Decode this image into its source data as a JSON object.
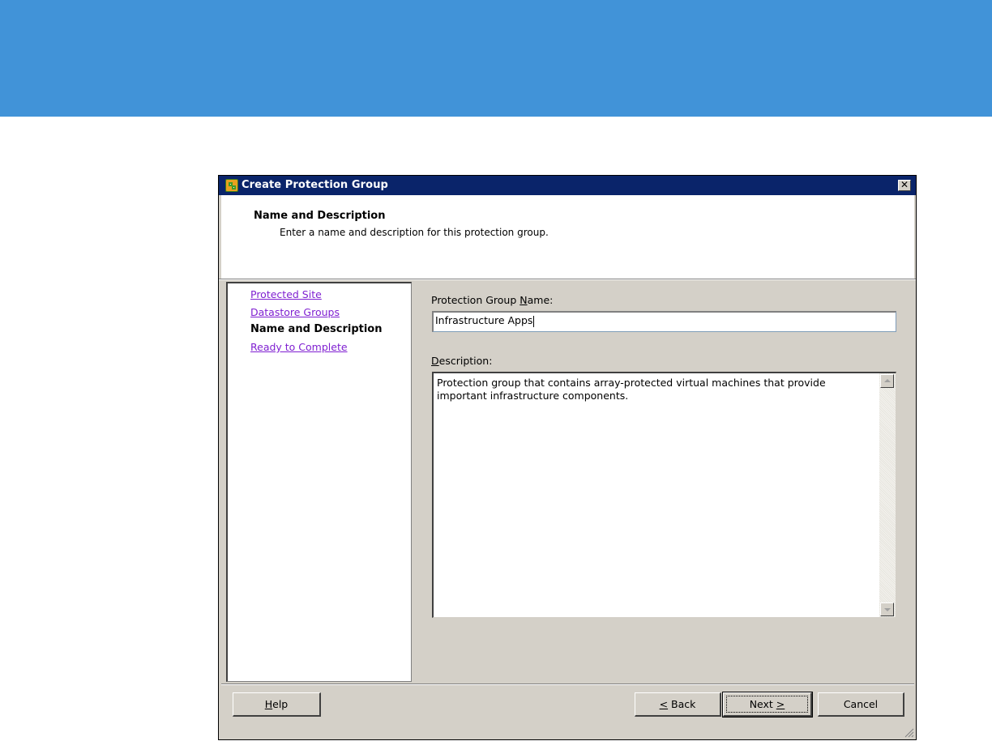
{
  "dialog": {
    "title": "Create Protection Group",
    "close_glyph": "✕",
    "header": {
      "title": "Name and Description",
      "subtitle": "Enter a name and description for this protection group."
    },
    "steps": [
      {
        "label": "Protected Site",
        "state": "link"
      },
      {
        "label": "Datastore Groups",
        "state": "link"
      },
      {
        "label": "Name and Description",
        "state": "current"
      },
      {
        "label": "Ready to Complete",
        "state": "link"
      }
    ],
    "name_field": {
      "label_pre": "Protection Group ",
      "label_accel": "N",
      "label_post": "ame:",
      "value": "Infrastructure Apps"
    },
    "description_field": {
      "label_accel": "D",
      "label_post": "escription:",
      "value": "Protection group that contains array-protected virtual machines that provide important infrastructure components."
    },
    "buttons": {
      "help_accel": "H",
      "help_post": "elp",
      "back_accel": "<",
      "back_post": " Back",
      "next_pre": "Next ",
      "next_accel": ">",
      "cancel": "Cancel"
    }
  },
  "colors": {
    "banner": "#4193d8",
    "titlebar": "#0a246a",
    "dialog_face": "#d4d0c8",
    "link": "#7f1fd1"
  },
  "icons": {
    "app": "vmware-srm-icon",
    "close": "close-icon",
    "scroll_up": "arrow-up-icon",
    "scroll_down": "arrow-down-icon",
    "grip": "resize-grip-icon"
  }
}
